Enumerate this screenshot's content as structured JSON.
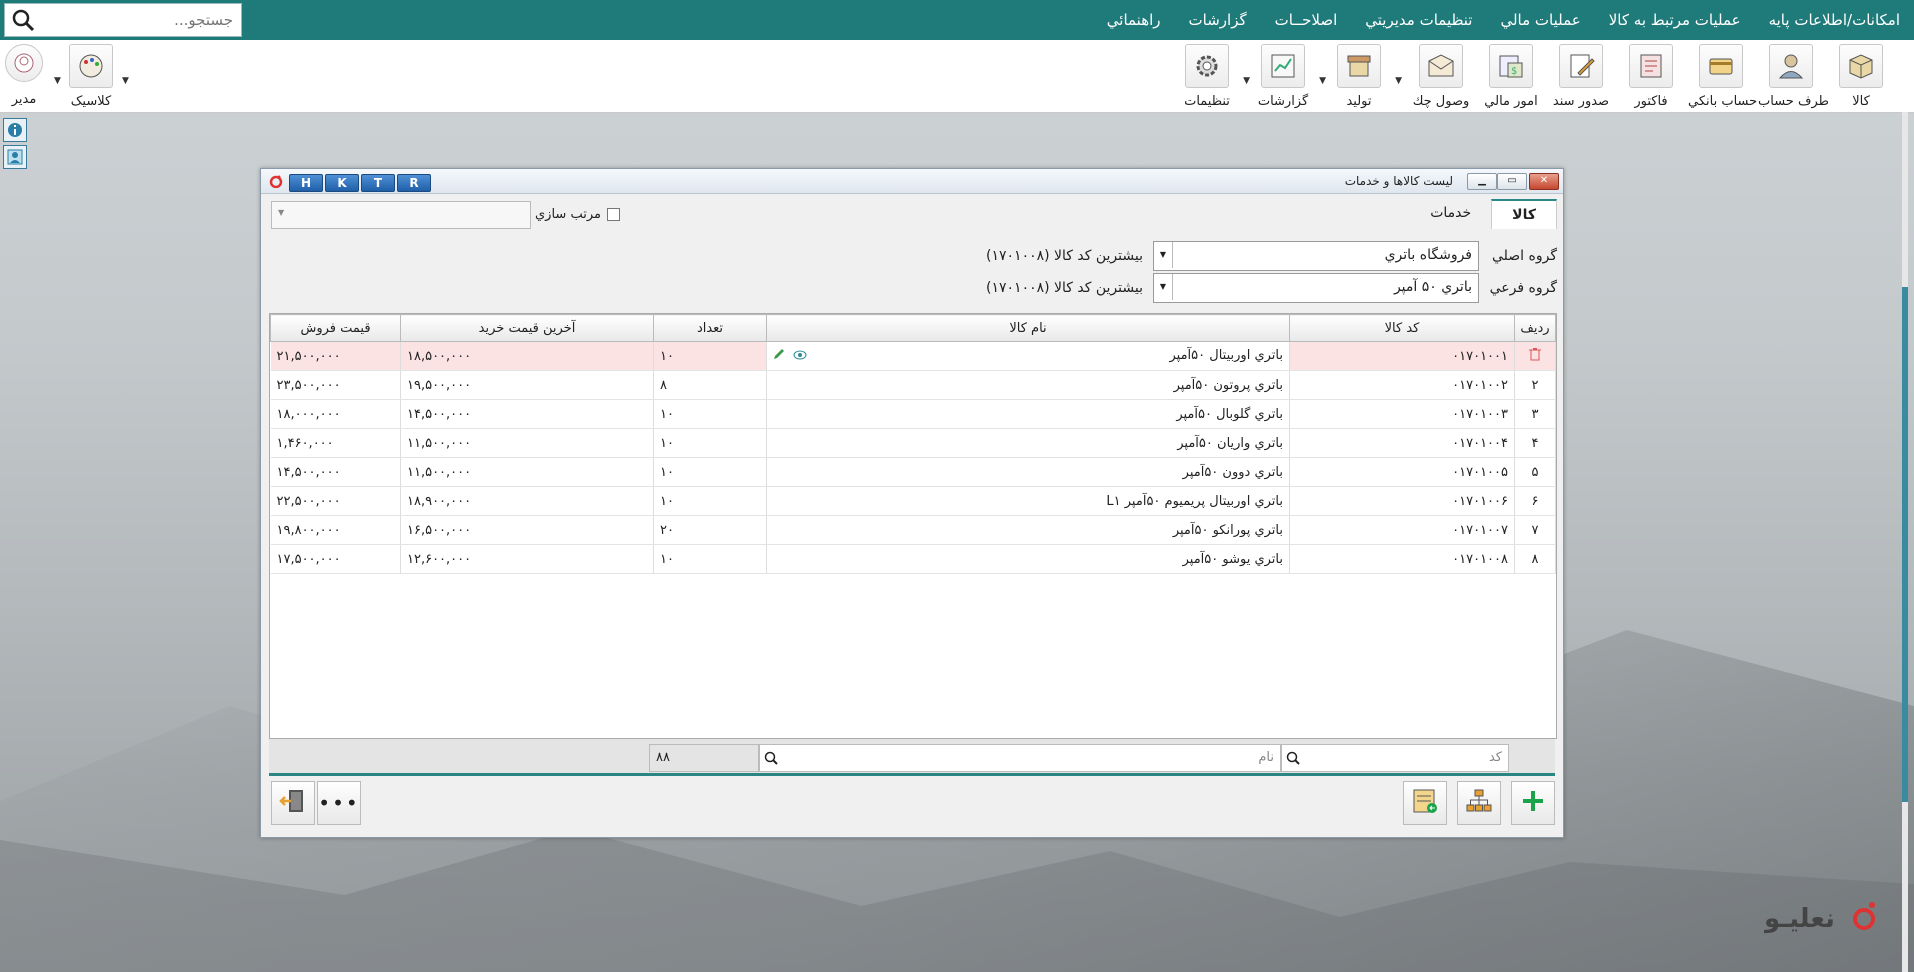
{
  "search": {
    "placeholder": "جستجو..."
  },
  "menu": [
    "امکانات/اطلاعات پايه",
    "عمليات مرتبط به کالا",
    "عمليات مالي",
    "تنظيمات مديريتي",
    "اصلاحــات",
    "گزارشات",
    "راهنمائي"
  ],
  "toolbar": {
    "items": [
      "کالا",
      "طرف حساب",
      "حساب بانکي",
      "فاکتور",
      "صدور سند",
      "امور مالي",
      "وصول چك",
      "توليد",
      "گزارشات",
      "تنظيمات"
    ],
    "theme_label": "کلاسيک",
    "user_label": "مدير"
  },
  "dialog": {
    "title": "ليست کالاها و خدمات",
    "hotkeys": [
      "R",
      "T",
      "K",
      "H"
    ],
    "tabs": [
      "کالا",
      "خدمات"
    ],
    "sort_label": "مرتب سازي",
    "main_group_label": "گروه اصلي",
    "main_group_value": "فروشگاه باتري",
    "main_group_info": "بيشترين کد کالا (۱۷۰۱۰۰۸)",
    "sub_group_label": "گروه فرعي",
    "sub_group_value": "باتري ۵۰ آمپر",
    "sub_group_info": "بيشترين کد کالا (۱۷۰۱۰۰۸)",
    "columns": [
      "رديف",
      "کد کالا",
      "نام کالا",
      "تعداد",
      "آخرين قيمت خريد",
      "قيمت فروش"
    ],
    "rows": [
      {
        "code": "۰۱۷۰۱۰۰۱",
        "name": "باتري اوربيتال ۵۰آمپر",
        "qty": "۱۰",
        "buy": "۱۸,۵۰۰,۰۰۰",
        "sell": "۲۱,۵۰۰,۰۰۰"
      },
      {
        "idx": "۲",
        "code": "۰۱۷۰۱۰۰۲",
        "name": "باتري پروتون ۵۰آمپر",
        "qty": "۸",
        "buy": "۱۹,۵۰۰,۰۰۰",
        "sell": "۲۳,۵۰۰,۰۰۰"
      },
      {
        "idx": "۳",
        "code": "۰۱۷۰۱۰۰۳",
        "name": "باتري گلوبال ۵۰آمپر",
        "qty": "۱۰",
        "buy": "۱۴,۵۰۰,۰۰۰",
        "sell": "۱۸,۰۰۰,۰۰۰"
      },
      {
        "idx": "۴",
        "code": "۰۱۷۰۱۰۰۴",
        "name": "باتري واريان ۵۰آمپر",
        "qty": "۱۰",
        "buy": "۱۱,۵۰۰,۰۰۰",
        "sell": "۱,۴۶۰,۰۰۰"
      },
      {
        "idx": "۵",
        "code": "۰۱۷۰۱۰۰۵",
        "name": "باتري دوون ۵۰آمپر",
        "qty": "۱۰",
        "buy": "۱۱,۵۰۰,۰۰۰",
        "sell": "۱۴,۵۰۰,۰۰۰"
      },
      {
        "idx": "۶",
        "code": "۰۱۷۰۱۰۰۶",
        "name": "باتري اوربيتال پريميوم ۵۰آمپر L۱",
        "qty": "۱۰",
        "buy": "۱۸,۹۰۰,۰۰۰",
        "sell": "۲۲,۵۰۰,۰۰۰"
      },
      {
        "idx": "۷",
        "code": "۰۱۷۰۱۰۰۷",
        "name": "باتري پورانکو ۵۰آمپر",
        "qty": "۲۰",
        "buy": "۱۶,۵۰۰,۰۰۰",
        "sell": "۱۹,۸۰۰,۰۰۰"
      },
      {
        "idx": "۸",
        "code": "۰۱۷۰۱۰۰۸",
        "name": "باتري يوشو ۵۰آمپر",
        "qty": "۱۰",
        "buy": "۱۲,۶۰۰,۰۰۰",
        "sell": "۱۷,۵۰۰,۰۰۰"
      }
    ],
    "filter_code_placeholder": "کد",
    "filter_name_placeholder": "نام",
    "total_qty": "۸۸"
  },
  "colors": {
    "accent": "#1f7a7a",
    "selected_row": "#fbe3e3"
  },
  "icons": [
    "search-icon",
    "box-icon",
    "person-icon",
    "bank-card-icon",
    "invoice-icon",
    "document-icon",
    "finance-icon",
    "check-icon",
    "production-icon",
    "report-icon",
    "gear-icon",
    "palette-icon",
    "user-icon",
    "info-icon",
    "trash-icon",
    "eye-icon",
    "pencil-icon",
    "plus-icon",
    "tree-icon",
    "export-icon",
    "more-icon",
    "exit-icon"
  ]
}
